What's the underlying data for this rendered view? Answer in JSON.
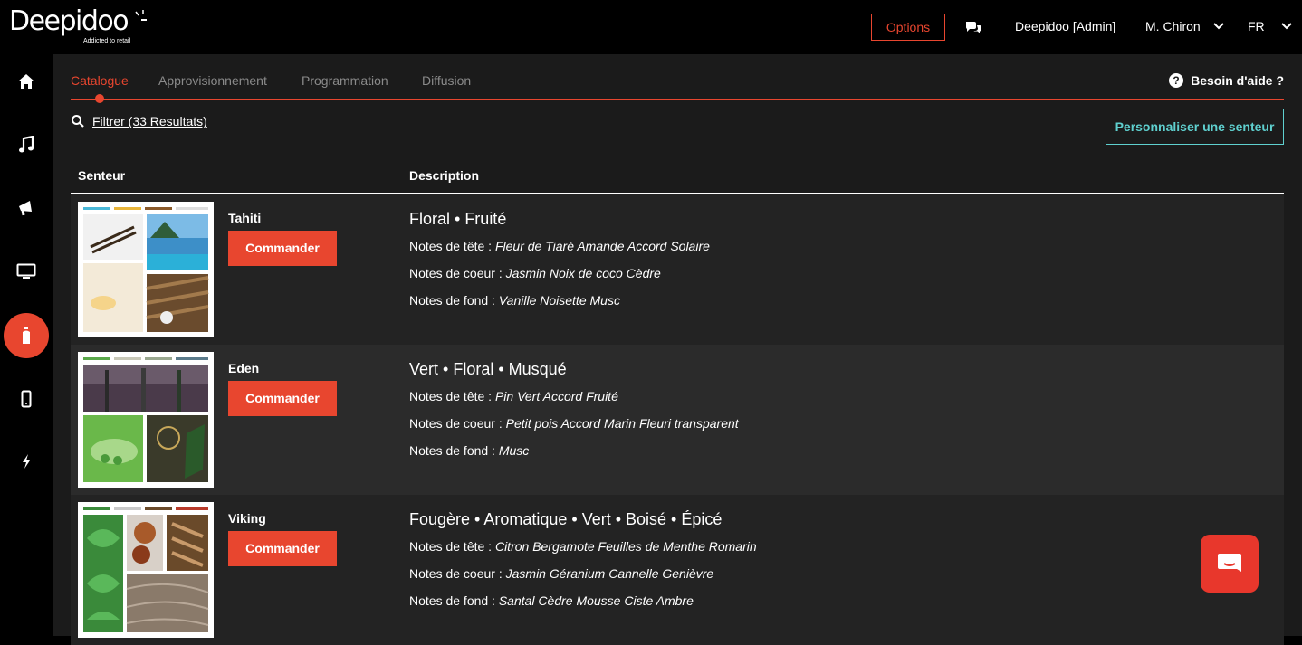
{
  "brand": {
    "name": "Deepidoo",
    "tagline": "Addicted to retail"
  },
  "topbar": {
    "options_label": "Options",
    "account_label": "Deepidoo [Admin]",
    "user_label": "M. Chiron",
    "language_label": "FR"
  },
  "sidebar": {
    "items": [
      {
        "icon": "home-icon"
      },
      {
        "icon": "music-icon"
      },
      {
        "icon": "megaphone-icon"
      },
      {
        "icon": "monitor-icon"
      },
      {
        "icon": "scent-diffuser-icon",
        "active": true
      },
      {
        "icon": "mobile-icon"
      },
      {
        "icon": "lightning-icon"
      }
    ]
  },
  "tabs": [
    {
      "label": "Catalogue",
      "active": true
    },
    {
      "label": "Approvisionnement"
    },
    {
      "label": "Programmation"
    },
    {
      "label": "Diffusion"
    }
  ],
  "help_label": "Besoin d'aide ?",
  "filter_label": "Filtrer (33 Resultats)",
  "custom_scent_label": "Personnaliser une senteur",
  "table": {
    "headers": {
      "scent": "Senteur",
      "description": "Description"
    },
    "note_labels": {
      "top": "Notes de tête : ",
      "heart": "Notes de coeur : ",
      "base": "Notes de fond : "
    },
    "order_label": "Commander",
    "rows": [
      {
        "name": "Tahiti",
        "families": "Floral • Fruité",
        "top": "Fleur de Tiaré Amande Accord Solaire",
        "heart": "Jasmin Noix de coco Cèdre",
        "base": "Vanille Noisette Musc"
      },
      {
        "name": "Eden",
        "families": "Vert • Floral • Musqué",
        "top": "Pin Vert Accord Fruité",
        "heart": "Petit pois Accord Marin Fleuri transparent",
        "base": "Musc"
      },
      {
        "name": "Viking",
        "families": "Fougère • Aromatique • Vert • Boisé • Épicé",
        "top": "Citron Bergamote Feuilles de Menthe Romarin",
        "heart": "Jasmin Géranium Cannelle Genièvre",
        "base": "Santal Cèdre Mousse Ciste Ambre"
      }
    ]
  },
  "colors": {
    "accent": "#e8462f",
    "teal": "#5fd0cf",
    "panel": "#1b1b1b"
  }
}
